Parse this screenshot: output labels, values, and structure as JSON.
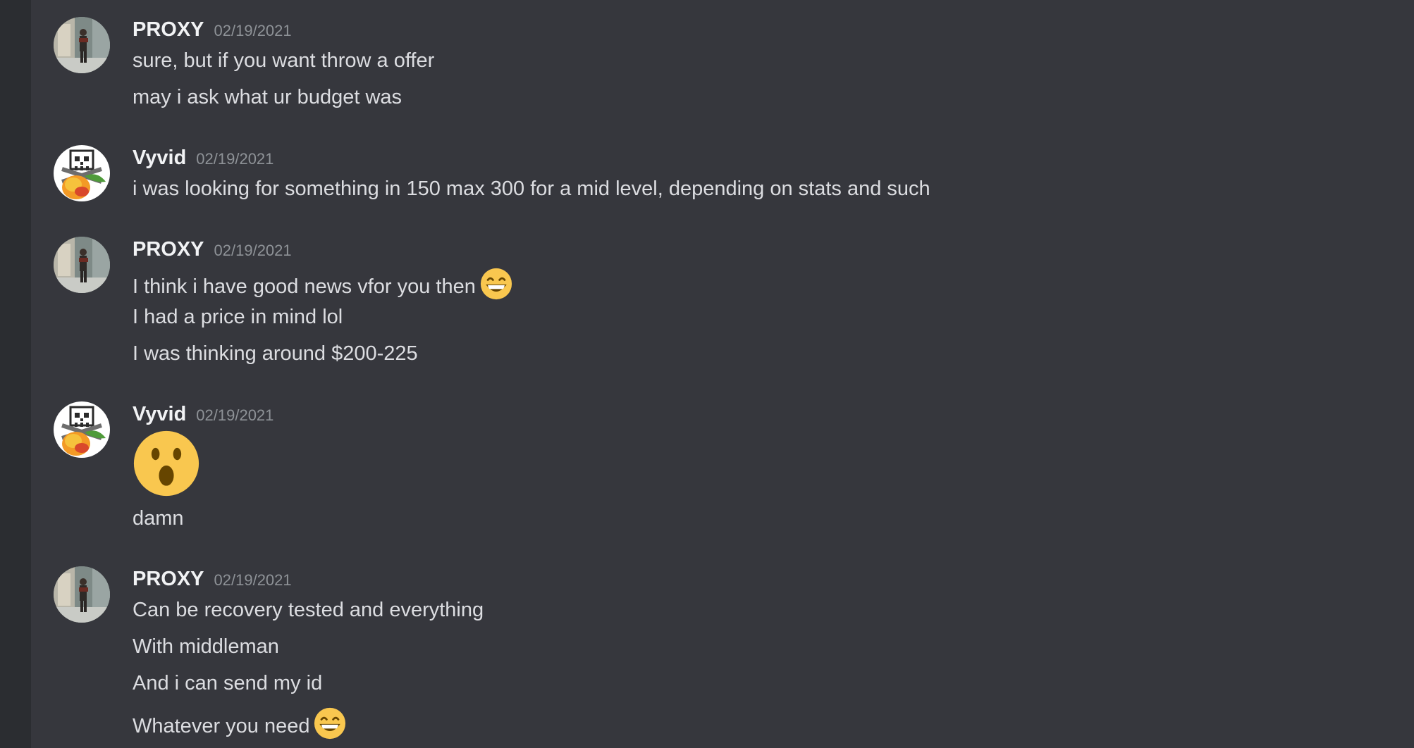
{
  "colors": {
    "background": "#36373d",
    "rail": "#2b2d31",
    "username": "#f2f3f5",
    "message": "#dcdde1",
    "timestamp": "#8e9297",
    "emoji_face": "#f9c74f"
  },
  "messages": [
    {
      "author": "PROXY",
      "timestamp": "02/19/2021",
      "avatar": "proxy-avatar",
      "lines": [
        "sure, but if you want throw a offer",
        "may i ask what ur budget was"
      ]
    },
    {
      "author": "Vyvid",
      "timestamp": "02/19/2021",
      "avatar": "vyvid-skull-mango-avatar",
      "lines": [
        "i was looking for something in 150 max 300 for a mid level, depending on stats and such"
      ]
    },
    {
      "author": "PROXY",
      "timestamp": "02/19/2021",
      "avatar": "proxy-avatar",
      "lines": [
        "I think i have good news vfor you then",
        "I had a price in mind lol",
        "I was thinking around $200-225"
      ],
      "emoji": "grinning-face-emoji"
    },
    {
      "author": "Vyvid",
      "timestamp": "02/19/2021",
      "avatar": "vyvid-skull-mango-avatar",
      "big_emoji": "open-mouth-face-emoji",
      "lines": [
        "damn"
      ]
    },
    {
      "author": "PROXY",
      "timestamp": "02/19/2021",
      "avatar": "proxy-avatar",
      "lines": [
        "Can be recovery tested and everything",
        "With middleman",
        "And i can send my id",
        "Whatever you need"
      ],
      "emoji": "grinning-face-emoji"
    }
  ]
}
